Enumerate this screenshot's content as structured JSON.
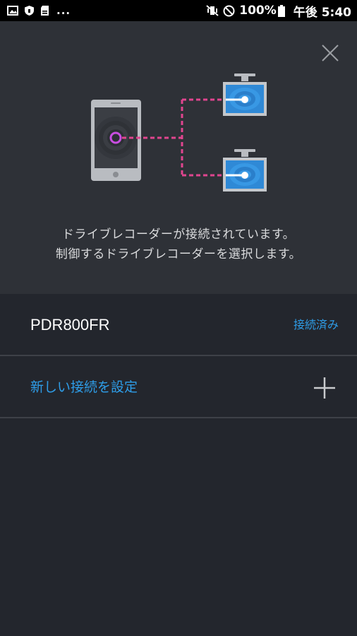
{
  "status_bar": {
    "dots": "...",
    "battery_percent": "100%",
    "time": "午後 5:40",
    "left_icons": [
      "image-icon",
      "shield-icon",
      "sd-card-icon"
    ],
    "right_icons": [
      "vibrate-icon",
      "do-not-disturb-icon",
      "battery-icon"
    ]
  },
  "header": {
    "message_line1": "ドライブレコーダーが接続されています。",
    "message_line2": "制御するドライブレコーダーを選択します。",
    "close_icon": "close-icon",
    "illustration": {
      "phone_icon": "smartphone-icon",
      "camera_icons": [
        "dashcam-icon",
        "dashcam-icon"
      ],
      "connection_color": "#e0458f",
      "phone_node_color": "#c84ee0",
      "camera_screen_color": "#2f89d6"
    }
  },
  "list": {
    "device": {
      "name": "PDR800FR",
      "status": "接続済み"
    },
    "new_connection": {
      "label": "新しい接続を設定",
      "icon": "plus-icon"
    }
  },
  "colors": {
    "background": "#23262d",
    "header_background": "#2e3137",
    "accent": "#2e9de8"
  }
}
